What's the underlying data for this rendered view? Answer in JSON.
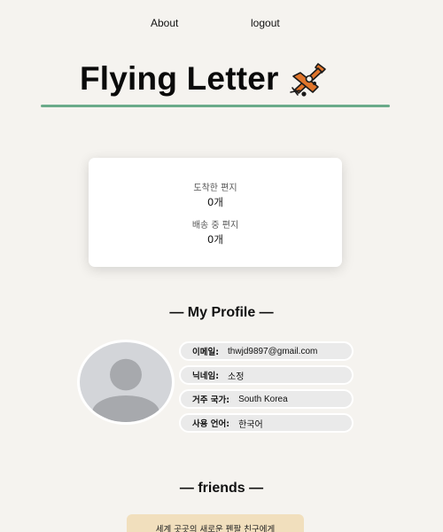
{
  "nav": {
    "about": "About",
    "logout": "logout"
  },
  "brand": {
    "title": "Flying Letter",
    "icon": "airplane-icon"
  },
  "stats": {
    "arrived_label": "도착한 편지",
    "arrived_value": "0개",
    "shipping_label": "배송 중 편지",
    "shipping_value": "0개"
  },
  "profile": {
    "title": "My Profile",
    "avatar_icon": "user-avatar-icon",
    "fields": [
      {
        "key": "이메일:",
        "value": "thwjd9897@gmail.com"
      },
      {
        "key": "닉네임:",
        "value": "소정"
      },
      {
        "key": "거주 국가:",
        "value": "South Korea"
      },
      {
        "key": "사용 언어:",
        "value": "한국어"
      }
    ]
  },
  "friends": {
    "title": "friends",
    "card_text": "세계 곳곳의 새로운 펜팔 친구에게"
  },
  "colors": {
    "background": "#f5f3ef",
    "accent_line": "#6aab8a",
    "friends_card": "#f1dfbd",
    "plane_body": "#e0752b"
  }
}
